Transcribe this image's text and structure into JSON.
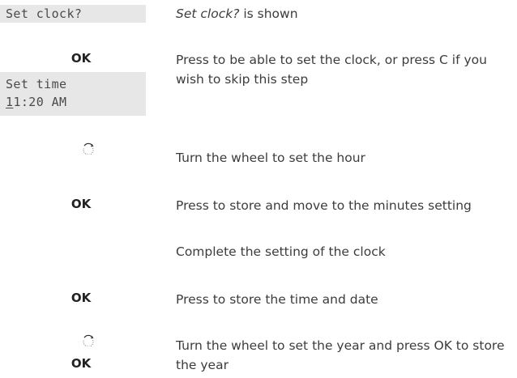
{
  "display_set_clock": {
    "line": "Set clock?"
  },
  "display_set_time": {
    "line1": "Set time",
    "cursor_digit": "1",
    "rest": "1:20 AM"
  },
  "icons": {
    "wheel": "wheel-icon"
  },
  "steps": [
    {
      "key": "",
      "desc_italic": "Set clock?",
      "desc": " is shown"
    },
    {
      "key": "OK",
      "desc": "Press to be able to set the clock, or press C if you wish to skip this step"
    },
    {
      "key": "",
      "desc": "Turn the wheel to set the hour"
    },
    {
      "key": "OK",
      "desc": "Press to store and move to the minutes setting"
    },
    {
      "key": "",
      "desc": "Complete the setting of the clock"
    },
    {
      "key": "OK",
      "desc": "Press to store the time and date"
    },
    {
      "key": "OK",
      "desc": "Turn the wheel to set the year and press OK to store the year"
    }
  ]
}
